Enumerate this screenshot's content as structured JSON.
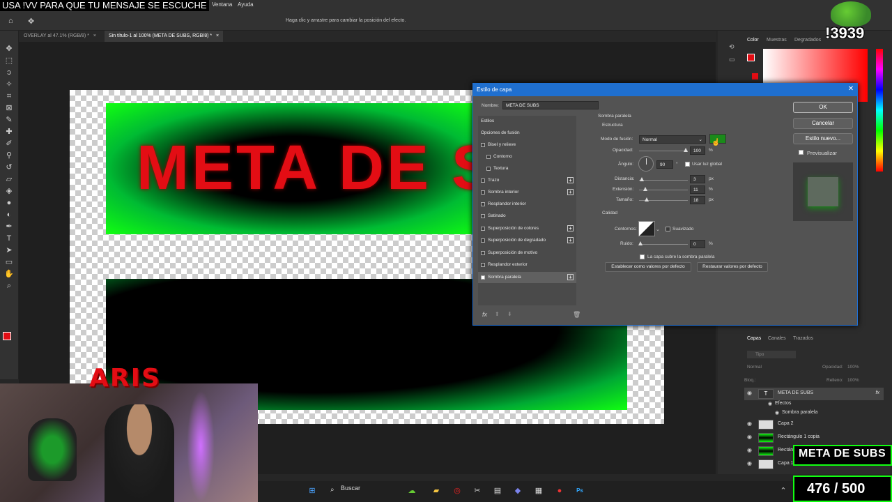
{
  "stream": {
    "banner": "USA !VV PARA QUE TU MENSAJE SE ESCUCHE",
    "webcam_name": "ARIS",
    "mascot_tag": "!3939",
    "goal_label": "META DE SUBS",
    "goal_count": "476 / 500"
  },
  "menu": {
    "items": [
      "Ventana",
      "Ayuda"
    ]
  },
  "options_bar": {
    "hint": "Haga clic y arrastre para cambiar la posición del efecto."
  },
  "tabs": [
    {
      "label": "OVERLAY al 47.1% (RGB/8) *",
      "close": "×"
    },
    {
      "label": "Sin título-1 al 100% (META DE SUBS, RGB/8) *",
      "close": "×"
    }
  ],
  "canvas": {
    "headline": "META DE S"
  },
  "right_panels": {
    "top_tabs": [
      "Color",
      "Muestras",
      "Degradados"
    ],
    "layers_tabs": [
      "Capas",
      "Canales",
      "Trazados"
    ],
    "filter_placeholder": "Tipo",
    "blend": "Normal",
    "opacity_label": "Opacidad:",
    "opacity_value": "100%",
    "lock_label": "Bloq.:",
    "fill_label": "Relleno:",
    "fill_value": "100%",
    "layers": [
      {
        "name": "META DE SUBS",
        "fx": "fx",
        "type": "T"
      },
      {
        "name": "Efectos"
      },
      {
        "name": "Sombra paralela"
      },
      {
        "name": "Capa 2"
      },
      {
        "name": "Rectángulo 1 copia"
      },
      {
        "name": "Rectáng"
      },
      {
        "name": "Capa 1"
      }
    ]
  },
  "dialog": {
    "title": "Estilo de capa",
    "name_label": "Nombre:",
    "name_value": "META DE SUBS",
    "styles_header": "Estilos",
    "blend_options": "Opciones de fusión",
    "styles": [
      {
        "label": "Bisel y relieve",
        "checked": false,
        "plus": false
      },
      {
        "label": "Contorno",
        "checked": false,
        "plus": false,
        "indent": true
      },
      {
        "label": "Textura",
        "checked": false,
        "plus": false,
        "indent": true
      },
      {
        "label": "Trazo",
        "checked": false,
        "plus": true
      },
      {
        "label": "Sombra interior",
        "checked": false,
        "plus": true
      },
      {
        "label": "Resplandor interior",
        "checked": false,
        "plus": false
      },
      {
        "label": "Satinado",
        "checked": false,
        "plus": false
      },
      {
        "label": "Superposición de colores",
        "checked": false,
        "plus": true
      },
      {
        "label": "Superposición de degradado",
        "checked": false,
        "plus": true
      },
      {
        "label": "Superposición de motivo",
        "checked": false,
        "plus": false
      },
      {
        "label": "Resplandor exterior",
        "checked": false,
        "plus": false
      },
      {
        "label": "Sombra paralela",
        "checked": true,
        "plus": true,
        "selected": true
      }
    ],
    "section_title": "Sombra paralela",
    "structure_title": "Estructura",
    "blend_mode_label": "Modo de fusión:",
    "blend_mode_value": "Normal",
    "shadow_color": "#1a8a1a",
    "opacity_label": "Opacidad:",
    "opacity_value": "100",
    "angle_label": "Ángulo:",
    "angle_value": "90",
    "angle_unit": "°",
    "global_light_label": "Usar luz global",
    "distance_label": "Distancia:",
    "distance_value": "3",
    "spread_label": "Extensión:",
    "spread_value": "11",
    "size_label": "Tamaño:",
    "size_value": "18",
    "unit_px": "px",
    "unit_pct": "%",
    "quality_title": "Calidad",
    "contour_label": "Contornos:",
    "antialias_label": "Suavizado",
    "noise_label": "Ruido:",
    "noise_value": "0",
    "knockout_label": "La capa cubre la sombra paralela",
    "make_default": "Establecer como valores por defecto",
    "reset_default": "Restaurar valores por defecto",
    "ok": "OK",
    "cancel": "Cancelar",
    "new_style": "Estilo nuevo...",
    "preview_label": "Previsualizar"
  },
  "taskbar": {
    "search": "Buscar"
  }
}
